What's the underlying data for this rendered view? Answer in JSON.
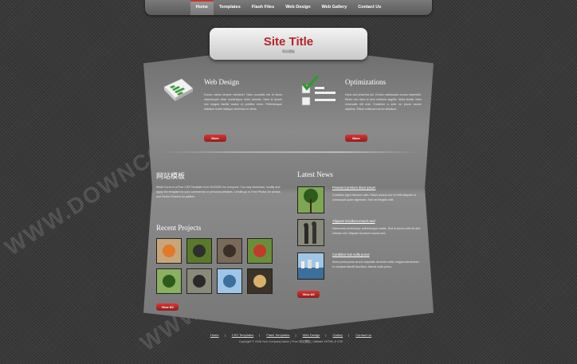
{
  "nav": {
    "items": [
      "Home",
      "Templates",
      "Flash Files",
      "Web Design",
      "Web Gallery",
      "Contact Us"
    ]
  },
  "site": {
    "title": "Site Title",
    "subtitle": "网站模板"
  },
  "web_design": {
    "heading": "Web Design",
    "text": "Donec varius tempor bendoriri. Nam convallis est et lacus ullamcorper vitae scelerisque enim lobortis. Nam id ipsum nec magna facilisi auctor ut porttitor enim. Pellentesque habitant morbi tristique senectus et netus.",
    "more": "More"
  },
  "optimizations": {
    "heading": "Optimizations",
    "text": "Nunc sed pharetra dui. Donec malesuada cursus imperdiet. Etiam nec risus ut sem vehicula sagittis. Nulla facilisi. Nam venenatis elit erat. Curabitur a ante eu ipsum auctor dapibus. Etiam euismod rutrum tincidunt.",
    "more": "More"
  },
  "about": {
    "heading": "网站模板",
    "text": "Metal Curve is a Free CSS Template from NCEDEH for everyone. You may download, modify and apply the template for your commercial or personal websites. Credits go to Free Photos for photos and Vector Flowers for pattern."
  },
  "projects": {
    "heading": "Recent Projects",
    "view_all": "View All",
    "thumbs": [
      "goldfish",
      "butterfly",
      "kittens",
      "tomato-salad",
      "tree",
      "people",
      "city-skyline",
      "lamp"
    ]
  },
  "news": {
    "heading": "Latest News",
    "items": [
      {
        "title": "Praesent pretium diam ipsum",
        "text": "Curabitur eget interdum nibh. Etiam cursus non mi felis aliquam ut consequat quam dignissim. Sed vel fringilla velit."
      },
      {
        "title": "Aliquam tincidunt mauris sed",
        "text": "Maecenas scelerisque pellentesque mattis. Sed ut ipsum velit sit ulmi ultricies nisi. Aliquam tincidunt mauris sed."
      },
      {
        "title": "Curabitur sus nulla purus",
        "text": "Nunc porta purus at orci vulputate sit amet mollis magna elementum. In volutpat blandit faucibus. Mauris nulla purus."
      }
    ],
    "view_all": "View All"
  },
  "footer": {
    "links": [
      "Home",
      "CSS Templates",
      "Flash Templates",
      "Web Design",
      "Gallery",
      "Contact Us"
    ],
    "copyright": "Copyright © 2048 Your Company Name | From 网站模板 | Validate XHTML & CSS"
  },
  "watermark": "WWW.DOWNCODE.COM"
}
